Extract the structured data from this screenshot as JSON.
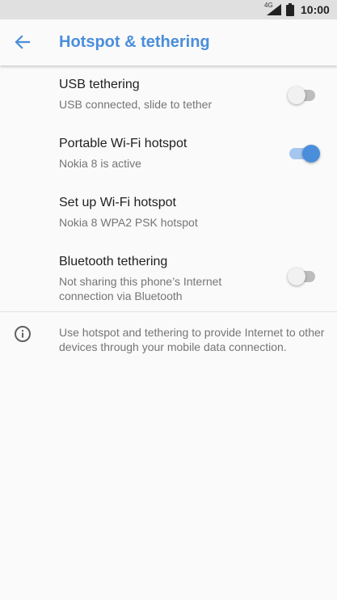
{
  "status_bar": {
    "network": "4G",
    "time": "10:00"
  },
  "app_bar": {
    "back_icon": "arrow-back-icon",
    "title": "Hotspot & tethering"
  },
  "settings": [
    {
      "title": "USB tethering",
      "subtitle": "USB connected, slide to tether",
      "toggle": "off"
    },
    {
      "title": "Portable Wi-Fi hotspot",
      "subtitle": "Nokia 8 is active",
      "toggle": "on"
    },
    {
      "title": "Set up Wi-Fi hotspot",
      "subtitle": "Nokia 8 WPA2 PSK hotspot"
    },
    {
      "title": "Bluetooth tethering",
      "subtitle": "Not sharing this phone’s Internet connection via Bluetooth",
      "toggle": "off"
    }
  ],
  "footer_info": {
    "icon": "info-icon",
    "text": "Use hotspot and tethering to provide Internet to other devices through your mobile data connection."
  },
  "colors": {
    "accent": "#4a8edb",
    "accent_track": "#a5c6ee",
    "status_bar_bg": "#e0e0e0",
    "background": "#fafafa",
    "primary_text": "#212121",
    "secondary_text": "#757575"
  }
}
